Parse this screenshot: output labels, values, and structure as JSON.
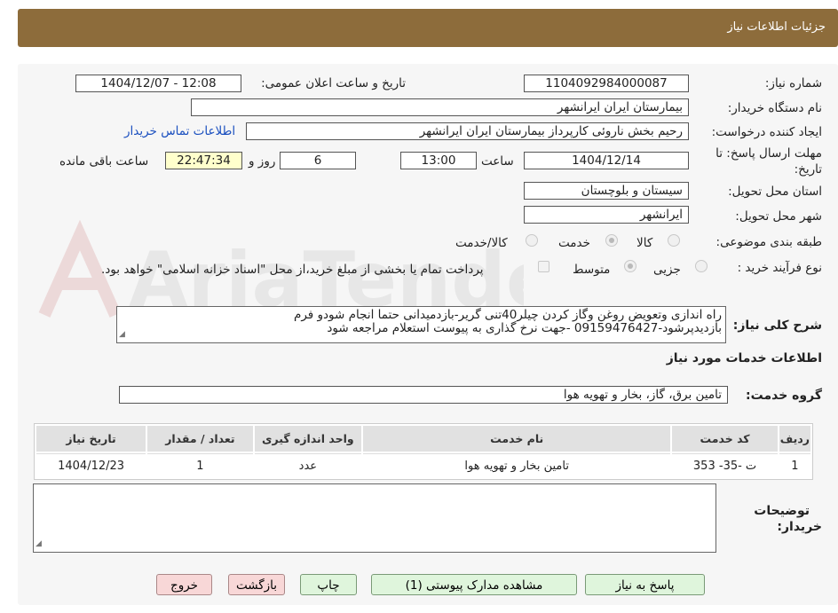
{
  "header": {
    "title": "جزئیات اطلاعات نیاز"
  },
  "watermark": {
    "text": "AriaTender.neT"
  },
  "fields": {
    "need_number_label": "شماره نیاز:",
    "need_number": "1104092984000087",
    "announce_label": "تاریخ و ساعت اعلان عمومی:",
    "announce_value": "1404/12/07 - 12:08",
    "buyer_org_label": "نام دستگاه خریدار:",
    "buyer_org": "بیمارستان ایران ایرانشهر",
    "creator_label": "ایجاد کننده درخواست:",
    "creator": "رحیم بخش ناروئی کارپرداز بیمارستان ایران ایرانشهر",
    "contact_link": "اطلاعات تماس خریدار",
    "deadline_label_1": "مهلت ارسال پاسخ: تا",
    "deadline_label_2": "تاریخ:",
    "deadline_date": "1404/12/14",
    "time_word": "ساعت",
    "deadline_time": "13:00",
    "days": "6",
    "days_word": "روز و",
    "remaining_time": "22:47:34",
    "remaining_word": "ساعت باقی مانده",
    "province_label": "استان محل تحویل:",
    "province": "سیستان و بلوچستان",
    "city_label": "شهر محل تحویل:",
    "city": "ایرانشهر",
    "category_label": "طبقه بندی موضوعی:",
    "category_options": [
      "کالا",
      "خدمت",
      "کالا/خدمت"
    ],
    "process_label": "نوع فرآیند خرید :",
    "process_options": [
      "جزیی",
      "متوسط"
    ],
    "payment_note": "پرداخت تمام یا بخشی از مبلغ خرید،از محل \"اسناد خزانه اسلامی\" خواهد بود.",
    "description_label": "شرح کلی نیاز:",
    "description_line1": "راه اندازی وتعویض روغن وگاز کردن چیلر40تنی گریر-بازدمیدانی حتما انجام شودو فرم",
    "description_line2": "بازدیدپرشود-09159476427 -جهت نرخ گذاری به پیوست استعلام مراجعه شود"
  },
  "services_section": {
    "title": "اطلاعات خدمات مورد نیاز",
    "group_label": "گروه خدمت:",
    "group_value": "تامین برق، گاز، بخار و تهویه هوا"
  },
  "table": {
    "headers": [
      "ردیف",
      "کد خدمت",
      "نام خدمت",
      "واحد اندازه گیری",
      "تعداد / مقدار",
      "تاریخ نیاز"
    ],
    "rows": [
      [
        "1",
        "ت -35- 353",
        "تامین بخار و تهویه هوا",
        "عدد",
        "1",
        "1404/12/23"
      ]
    ]
  },
  "buyer_notes_label_1": "توضیحات",
  "buyer_notes_label_2": "خریدار:",
  "buttons": {
    "reply": "پاسخ به نیاز",
    "attachments": "مشاهده مدارک پیوستی (1)",
    "print": "چاپ",
    "back": "بازگشت",
    "exit": "خروج"
  },
  "colors": {
    "header_bg": "#8d6c3b",
    "panel_bg": "#f6f6f6",
    "link": "#1a4fbf"
  }
}
